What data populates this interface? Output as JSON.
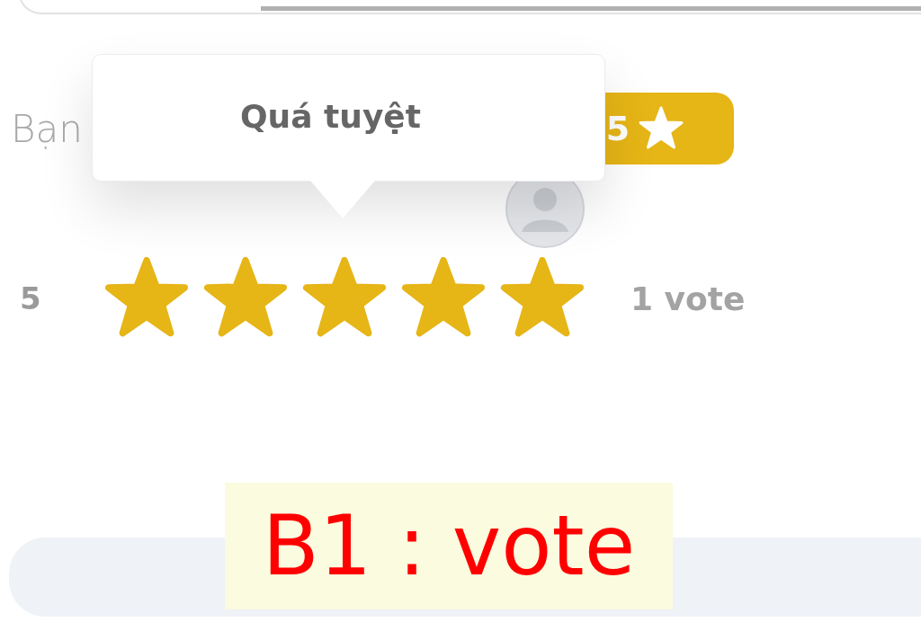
{
  "heading": "Bạn",
  "score_badge": {
    "value": "5"
  },
  "tooltip": {
    "text": "Quá tuyệt"
  },
  "rating": {
    "label": "5",
    "stars": 5,
    "count": "1 vote"
  },
  "annotation": "B1 : vote"
}
